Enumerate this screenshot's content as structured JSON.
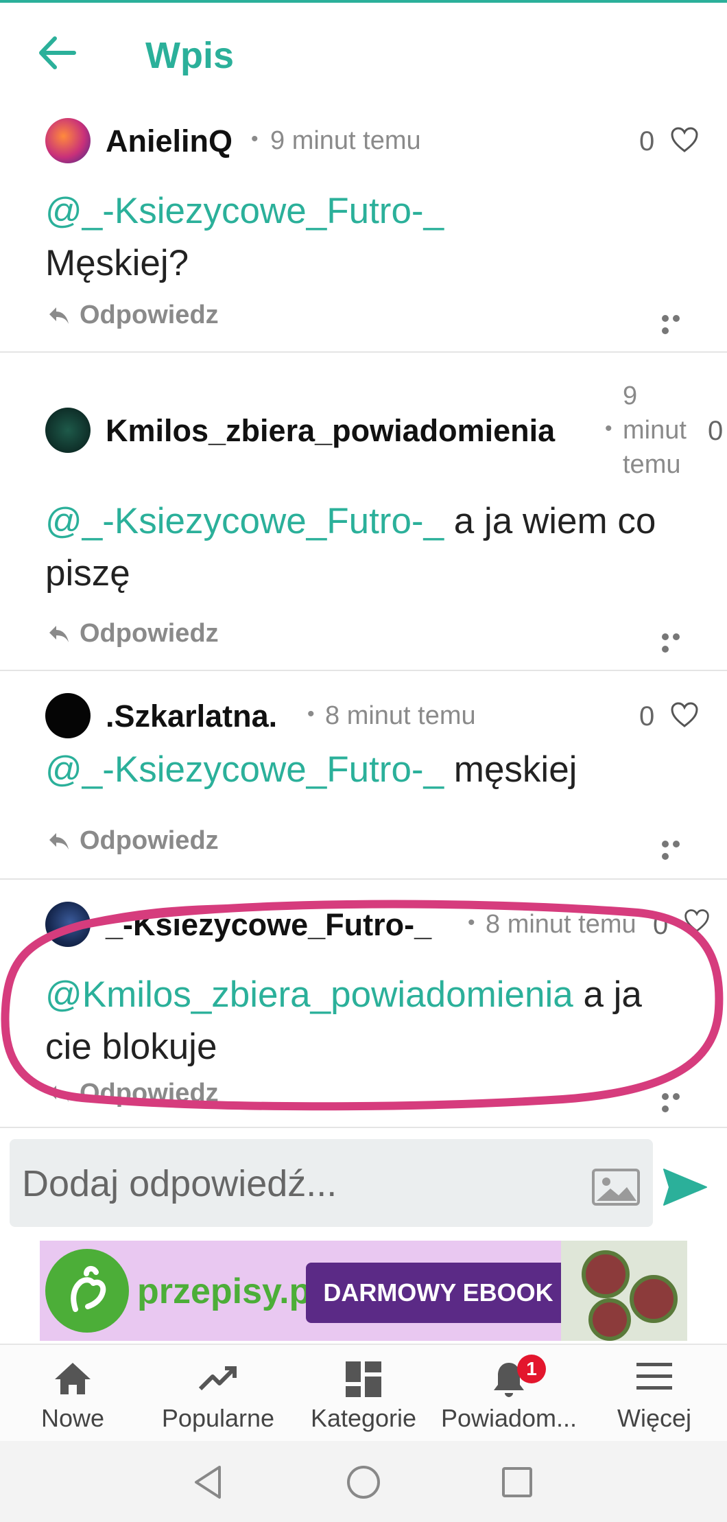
{
  "header": {
    "title": "Wpis"
  },
  "comments": [
    {
      "author": "AnielinQ",
      "time": "9 minut temu",
      "likes": "0",
      "mention": "@_-Ksiezycowe_Futro-_",
      "text": "Męskiej?",
      "reply_label": "Odpowiedz"
    },
    {
      "author": "Kmilos_zbiera_powiadomienia",
      "time_parts": [
        "9",
        "minut",
        "temu"
      ],
      "likes": "0",
      "mention": "@_-Ksiezycowe_Futro-_",
      "text": "a ja wiem co piszę",
      "reply_label": "Odpowiedz"
    },
    {
      "author": ".Szkarlatna.",
      "time": "8 minut temu",
      "likes": "0",
      "mention": "@_-Ksiezycowe_Futro-_",
      "text": "męskiej",
      "reply_label": "Odpowiedz"
    },
    {
      "author": "_-Ksiezycowe_Futro-_",
      "time": "8 minut temu",
      "likes": "0",
      "mention": "@Kmilos_zbiera_powiadomienia",
      "text": "a ja cie blokuje",
      "reply_label": "Odpowiedz"
    }
  ],
  "composer": {
    "placeholder": "Dodaj odpowiedź..."
  },
  "ad": {
    "brand": "przepisy.pl",
    "cta": "DARMOWY EBOOK"
  },
  "bottom_nav": [
    {
      "label": "Nowe",
      "icon": "home-icon"
    },
    {
      "label": "Popularne",
      "icon": "trending-icon"
    },
    {
      "label": "Kategorie",
      "icon": "dashboard-icon"
    },
    {
      "label": "Powiadom...",
      "icon": "bell-icon",
      "badge": "1"
    },
    {
      "label": "Więcej",
      "icon": "menu-icon"
    }
  ],
  "colors": {
    "accent": "#2bb09a",
    "badge": "#e3162d",
    "highlight": "#d63c7d"
  }
}
